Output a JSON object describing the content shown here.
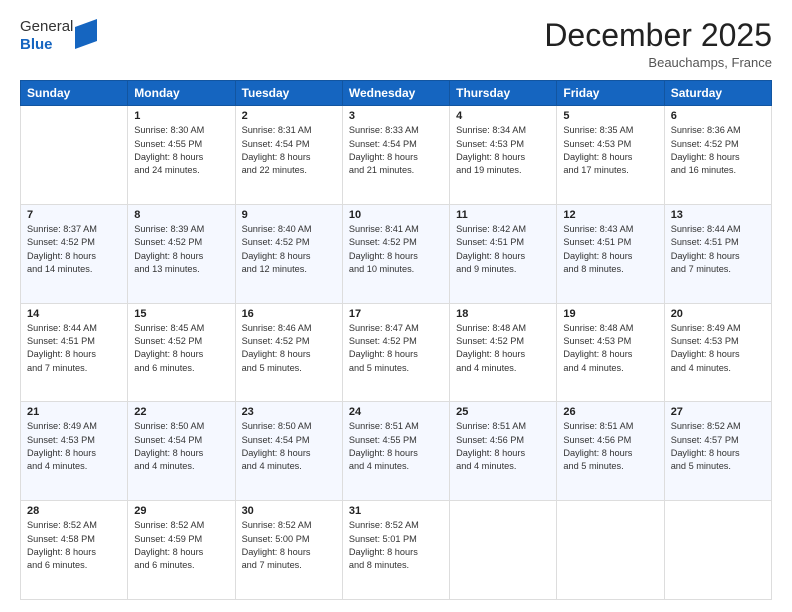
{
  "header": {
    "logo_general": "General",
    "logo_blue": "Blue",
    "month_title": "December 2025",
    "subtitle": "Beauchamps, France"
  },
  "days_of_week": [
    "Sunday",
    "Monday",
    "Tuesday",
    "Wednesday",
    "Thursday",
    "Friday",
    "Saturday"
  ],
  "weeks": [
    [
      {
        "num": "",
        "info": ""
      },
      {
        "num": "1",
        "info": "Sunrise: 8:30 AM\nSunset: 4:55 PM\nDaylight: 8 hours\nand 24 minutes."
      },
      {
        "num": "2",
        "info": "Sunrise: 8:31 AM\nSunset: 4:54 PM\nDaylight: 8 hours\nand 22 minutes."
      },
      {
        "num": "3",
        "info": "Sunrise: 8:33 AM\nSunset: 4:54 PM\nDaylight: 8 hours\nand 21 minutes."
      },
      {
        "num": "4",
        "info": "Sunrise: 8:34 AM\nSunset: 4:53 PM\nDaylight: 8 hours\nand 19 minutes."
      },
      {
        "num": "5",
        "info": "Sunrise: 8:35 AM\nSunset: 4:53 PM\nDaylight: 8 hours\nand 17 minutes."
      },
      {
        "num": "6",
        "info": "Sunrise: 8:36 AM\nSunset: 4:52 PM\nDaylight: 8 hours\nand 16 minutes."
      }
    ],
    [
      {
        "num": "7",
        "info": "Sunrise: 8:37 AM\nSunset: 4:52 PM\nDaylight: 8 hours\nand 14 minutes."
      },
      {
        "num": "8",
        "info": "Sunrise: 8:39 AM\nSunset: 4:52 PM\nDaylight: 8 hours\nand 13 minutes."
      },
      {
        "num": "9",
        "info": "Sunrise: 8:40 AM\nSunset: 4:52 PM\nDaylight: 8 hours\nand 12 minutes."
      },
      {
        "num": "10",
        "info": "Sunrise: 8:41 AM\nSunset: 4:52 PM\nDaylight: 8 hours\nand 10 minutes."
      },
      {
        "num": "11",
        "info": "Sunrise: 8:42 AM\nSunset: 4:51 PM\nDaylight: 8 hours\nand 9 minutes."
      },
      {
        "num": "12",
        "info": "Sunrise: 8:43 AM\nSunset: 4:51 PM\nDaylight: 8 hours\nand 8 minutes."
      },
      {
        "num": "13",
        "info": "Sunrise: 8:44 AM\nSunset: 4:51 PM\nDaylight: 8 hours\nand 7 minutes."
      }
    ],
    [
      {
        "num": "14",
        "info": "Sunrise: 8:44 AM\nSunset: 4:51 PM\nDaylight: 8 hours\nand 7 minutes."
      },
      {
        "num": "15",
        "info": "Sunrise: 8:45 AM\nSunset: 4:52 PM\nDaylight: 8 hours\nand 6 minutes."
      },
      {
        "num": "16",
        "info": "Sunrise: 8:46 AM\nSunset: 4:52 PM\nDaylight: 8 hours\nand 5 minutes."
      },
      {
        "num": "17",
        "info": "Sunrise: 8:47 AM\nSunset: 4:52 PM\nDaylight: 8 hours\nand 5 minutes."
      },
      {
        "num": "18",
        "info": "Sunrise: 8:48 AM\nSunset: 4:52 PM\nDaylight: 8 hours\nand 4 minutes."
      },
      {
        "num": "19",
        "info": "Sunrise: 8:48 AM\nSunset: 4:53 PM\nDaylight: 8 hours\nand 4 minutes."
      },
      {
        "num": "20",
        "info": "Sunrise: 8:49 AM\nSunset: 4:53 PM\nDaylight: 8 hours\nand 4 minutes."
      }
    ],
    [
      {
        "num": "21",
        "info": "Sunrise: 8:49 AM\nSunset: 4:53 PM\nDaylight: 8 hours\nand 4 minutes."
      },
      {
        "num": "22",
        "info": "Sunrise: 8:50 AM\nSunset: 4:54 PM\nDaylight: 8 hours\nand 4 minutes."
      },
      {
        "num": "23",
        "info": "Sunrise: 8:50 AM\nSunset: 4:54 PM\nDaylight: 8 hours\nand 4 minutes."
      },
      {
        "num": "24",
        "info": "Sunrise: 8:51 AM\nSunset: 4:55 PM\nDaylight: 8 hours\nand 4 minutes."
      },
      {
        "num": "25",
        "info": "Sunrise: 8:51 AM\nSunset: 4:56 PM\nDaylight: 8 hours\nand 4 minutes."
      },
      {
        "num": "26",
        "info": "Sunrise: 8:51 AM\nSunset: 4:56 PM\nDaylight: 8 hours\nand 5 minutes."
      },
      {
        "num": "27",
        "info": "Sunrise: 8:52 AM\nSunset: 4:57 PM\nDaylight: 8 hours\nand 5 minutes."
      }
    ],
    [
      {
        "num": "28",
        "info": "Sunrise: 8:52 AM\nSunset: 4:58 PM\nDaylight: 8 hours\nand 6 minutes."
      },
      {
        "num": "29",
        "info": "Sunrise: 8:52 AM\nSunset: 4:59 PM\nDaylight: 8 hours\nand 6 minutes."
      },
      {
        "num": "30",
        "info": "Sunrise: 8:52 AM\nSunset: 5:00 PM\nDaylight: 8 hours\nand 7 minutes."
      },
      {
        "num": "31",
        "info": "Sunrise: 8:52 AM\nSunset: 5:01 PM\nDaylight: 8 hours\nand 8 minutes."
      },
      {
        "num": "",
        "info": ""
      },
      {
        "num": "",
        "info": ""
      },
      {
        "num": "",
        "info": ""
      }
    ]
  ]
}
